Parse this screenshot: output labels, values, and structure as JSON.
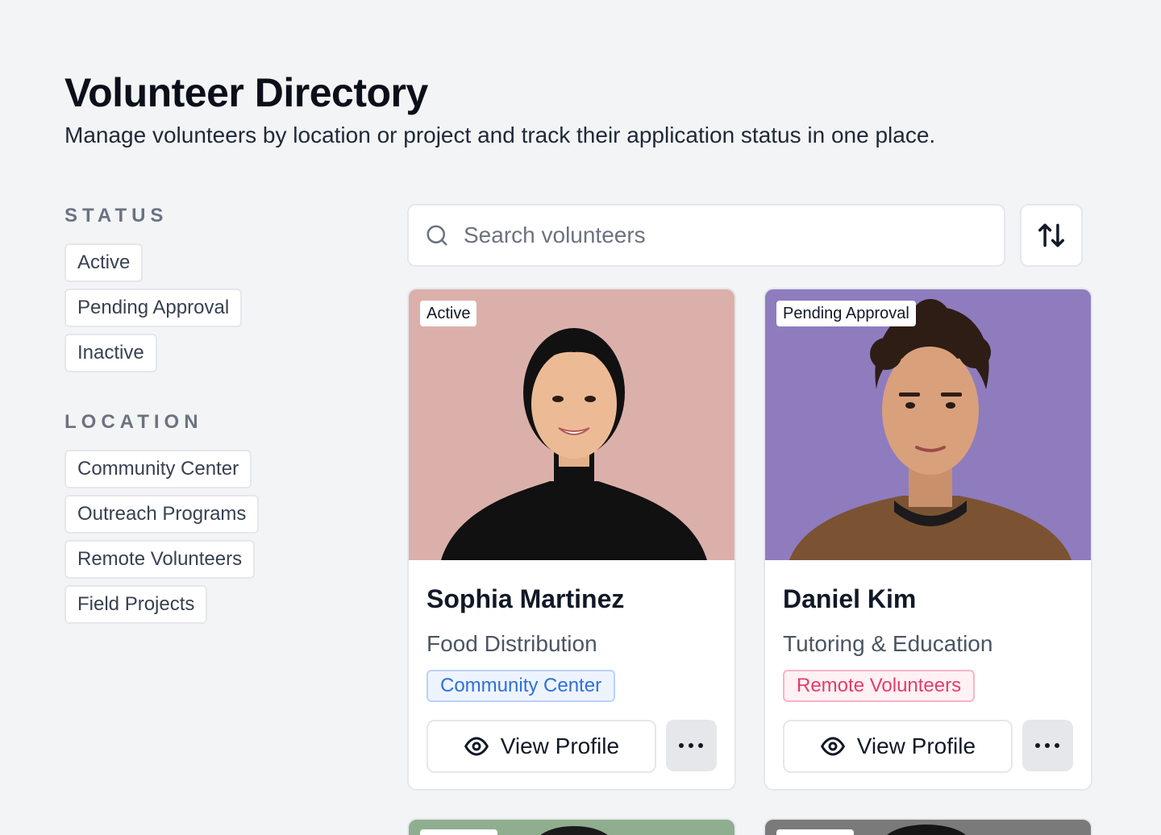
{
  "header": {
    "title": "Volunteer Directory",
    "subtitle": "Manage volunteers by location or project and track their application status in one place."
  },
  "filters": {
    "status": {
      "heading": "STATUS",
      "options": [
        "Active",
        "Pending Approval",
        "Inactive"
      ]
    },
    "location": {
      "heading": "LOCATION",
      "options": [
        "Community Center",
        "Outreach Programs",
        "Remote Volunteers",
        "Field Projects"
      ]
    }
  },
  "search": {
    "placeholder": "Search volunteers",
    "icon": "search-icon"
  },
  "sort": {
    "icon": "sort-arrows-icon"
  },
  "volunteers": [
    {
      "status": "Active",
      "name": "Sophia Martinez",
      "role": "Food Distribution",
      "location": "Community Center",
      "location_color": "#2f6fde",
      "photo_bg": "#d8aaa4",
      "view_label": "View Profile"
    },
    {
      "status": "Pending Approval",
      "name": "Daniel Kim",
      "role": "Tutoring & Education",
      "location": "Remote Volunteers",
      "location_color": "#e43c6a",
      "photo_bg": "#8e7cbf",
      "view_label": "View Profile"
    }
  ]
}
